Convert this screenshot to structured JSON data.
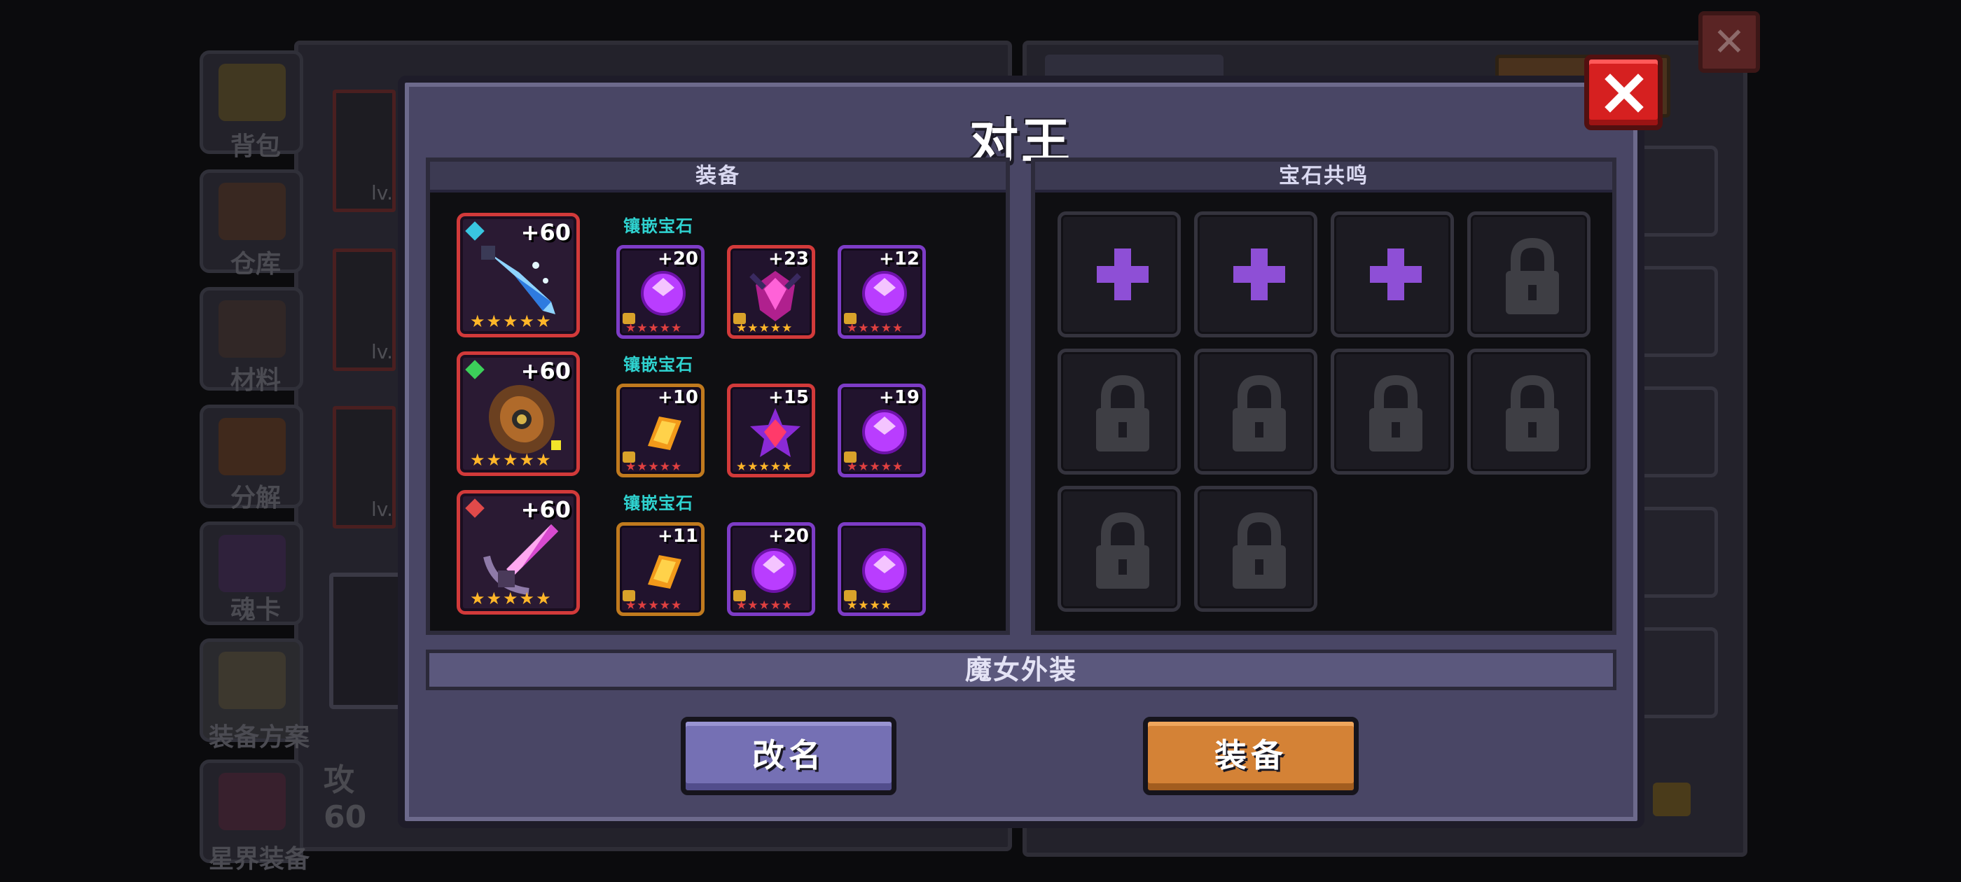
{
  "background": {
    "sidebar_labels": [
      "背包",
      "仓库",
      "材料",
      "分解",
      "魂卡",
      "装备方案",
      "星界装备"
    ],
    "card_level_prefix": "lv.",
    "attack_label": "攻",
    "attack_value": "60"
  },
  "modal": {
    "title": "对王",
    "close_icon": "close-x-icon",
    "equip_section_title": "装备",
    "gem_section_title": "宝石共鸣",
    "inlay_label": "镶嵌宝石",
    "weapons": [
      {
        "level": "+60",
        "stars": "★★★★★",
        "gem_color": "#39c6e0",
        "icon": "frost-dagger-icon",
        "gems": [
          {
            "level": "+20",
            "stars": "★★★★★",
            "frame": "purple",
            "icon": "purple-gem-icon",
            "locked": true
          },
          {
            "level": "+23",
            "stars": "★★★★★",
            "frame": "red",
            "icon": "crimson-crystal-icon",
            "locked": true
          },
          {
            "level": "+12",
            "stars": "★★★★★",
            "frame": "purple",
            "icon": "purple-gem-icon",
            "locked": true
          }
        ]
      },
      {
        "level": "+60",
        "stars": "★★★★★",
        "gem_color": "#3ccf5a",
        "icon": "bronze-shield-icon",
        "gems": [
          {
            "level": "+10",
            "stars": "★★★★★",
            "frame": "orange",
            "icon": "amber-scroll-icon",
            "locked": true
          },
          {
            "level": "+15",
            "stars": "★★★★★",
            "frame": "red",
            "icon": "ruby-star-icon",
            "locked": false
          },
          {
            "level": "+19",
            "stars": "★★★★★",
            "frame": "purple",
            "icon": "purple-gem-icon",
            "locked": true
          }
        ]
      },
      {
        "level": "+60",
        "stars": "★★★★★",
        "gem_color": "#e04a4a",
        "icon": "pink-blade-icon",
        "gems": [
          {
            "level": "+11",
            "stars": "★★★★★",
            "frame": "orange",
            "icon": "amber-scroll-icon",
            "locked": true
          },
          {
            "level": "+20",
            "stars": "★★★★★",
            "frame": "purple",
            "icon": "purple-gem-icon",
            "locked": true
          },
          {
            "level": "",
            "stars": "★★★★",
            "frame": "purple",
            "icon": "purple-gem-icon",
            "locked": true
          }
        ]
      }
    ],
    "resonance_slots": [
      "add",
      "add",
      "add",
      "locked",
      "locked",
      "locked",
      "locked",
      "locked",
      "locked",
      "locked"
    ],
    "outfit_name": "魔女外装",
    "rename_button": "改名",
    "equip_button": "装备"
  },
  "colors": {
    "modal_bg": "#494665",
    "close_red": "#d62020",
    "rename_purple": "#7570b4",
    "equip_orange": "#d48236",
    "plus_purple": "#8e4fd6",
    "star_gold": "#ffb629",
    "inlay_cyan": "#2fd3d0"
  }
}
